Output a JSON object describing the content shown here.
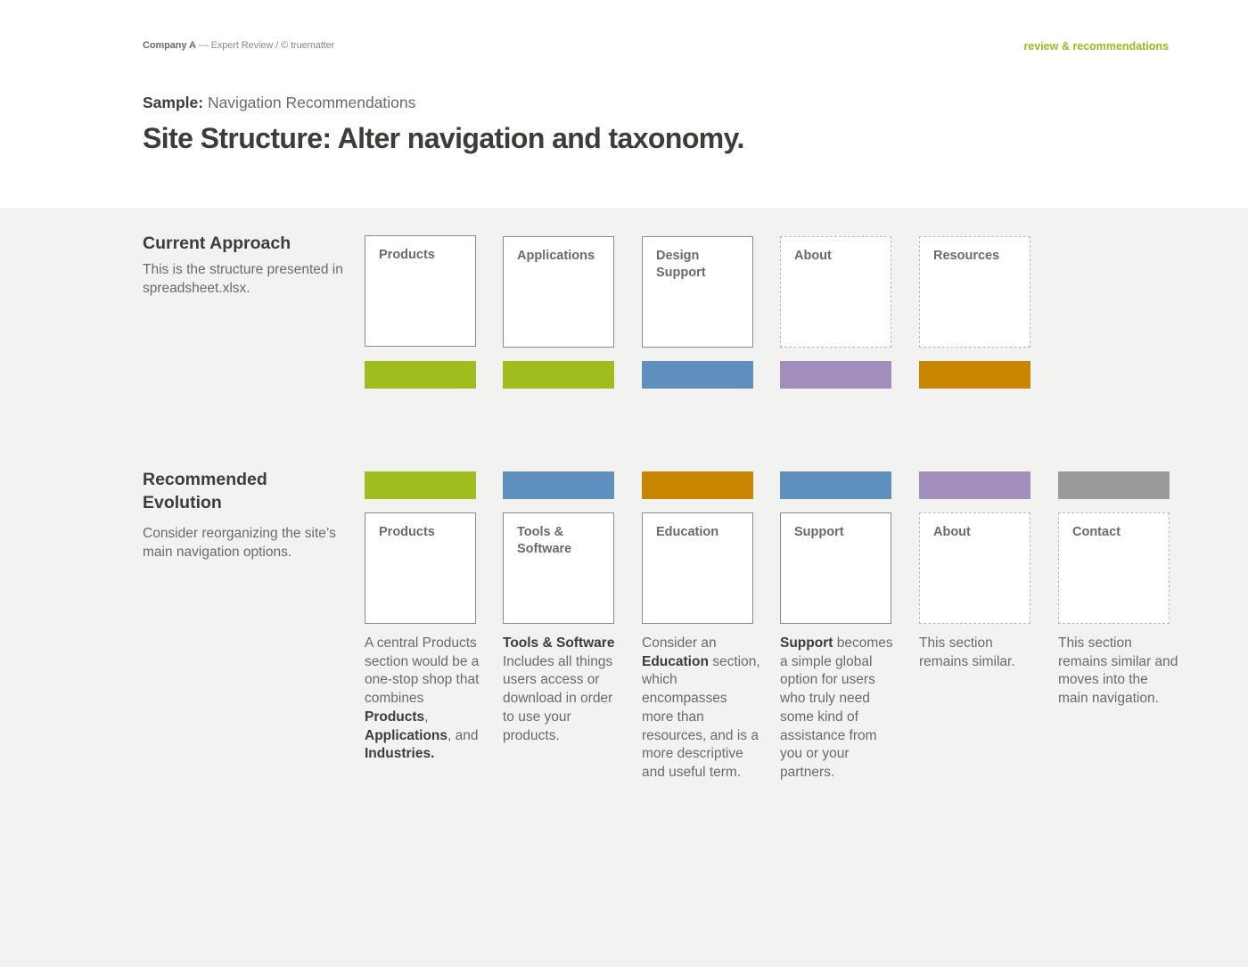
{
  "header": {
    "company": "Company A",
    "meta_rest": " — Expert Review / © truematter",
    "tag": "review & recommendations",
    "subtitle_label": "Sample:",
    "subtitle_text": " Navigation Recommendations",
    "title": "Site Structure: Alter navigation and taxonomy."
  },
  "colors": {
    "green": "#9fbd1f",
    "blue": "#5f8fbd",
    "orange": "#c88600",
    "purple": "#a28eba",
    "gray": "#9a9a9a",
    "accent": "#9cbb1c"
  },
  "current": {
    "heading": "Current Approach",
    "description": "This is the structure presented in spreadsheet.xlsx.",
    "items": [
      {
        "label": "Products",
        "color": "#9fbd1f",
        "style": "solid"
      },
      {
        "label": "Applications",
        "color": "#9fbd1f",
        "style": "solid"
      },
      {
        "label": "Design Support",
        "color": "#5f8fbd",
        "style": "solid"
      },
      {
        "label": "About",
        "color": "#a28eba",
        "style": "dotted"
      },
      {
        "label": "Resources",
        "color": "#c88600",
        "style": "dotted"
      }
    ]
  },
  "recommended": {
    "heading": "Recommended Evolution",
    "description": "Consider reorganizing the site’s main navigation options.",
    "items": [
      {
        "label": "Products",
        "color": "#9fbd1f",
        "style": "solid",
        "desc": [
          {
            "t": "A central Products section would be a one-stop shop that combines "
          },
          {
            "t": "Products",
            "b": true
          },
          {
            "t": ", "
          },
          {
            "t": "Applications",
            "b": true
          },
          {
            "t": ", and "
          },
          {
            "t": "Industries.",
            "b": true
          }
        ]
      },
      {
        "label": "Tools & Software",
        "color": "#5f8fbd",
        "style": "solid",
        "desc": [
          {
            "t": "Tools & Software",
            "b": true
          },
          {
            "t": " Includes all things users access or download in order to use your products."
          }
        ]
      },
      {
        "label": "Education",
        "color": "#c88600",
        "style": "solid",
        "desc": [
          {
            "t": "Consider an "
          },
          {
            "t": "Education",
            "b": true
          },
          {
            "t": " section, which encompasses more than resources, and is a more descriptive and useful term."
          }
        ]
      },
      {
        "label": "Support",
        "color": "#5f8fbd",
        "style": "solid",
        "desc": [
          {
            "t": "Support",
            "b": true
          },
          {
            "t": " becomes a simple global option for users who truly need some kind of assistance from you or your partners."
          }
        ]
      },
      {
        "label": "About",
        "color": "#a28eba",
        "style": "dotted",
        "desc": [
          {
            "t": "This section remains similar."
          }
        ]
      },
      {
        "label": "Contact",
        "color": "#9a9a9a",
        "style": "dotted",
        "desc": [
          {
            "t": "This section remains similar and moves into the main navigation."
          }
        ]
      }
    ]
  }
}
